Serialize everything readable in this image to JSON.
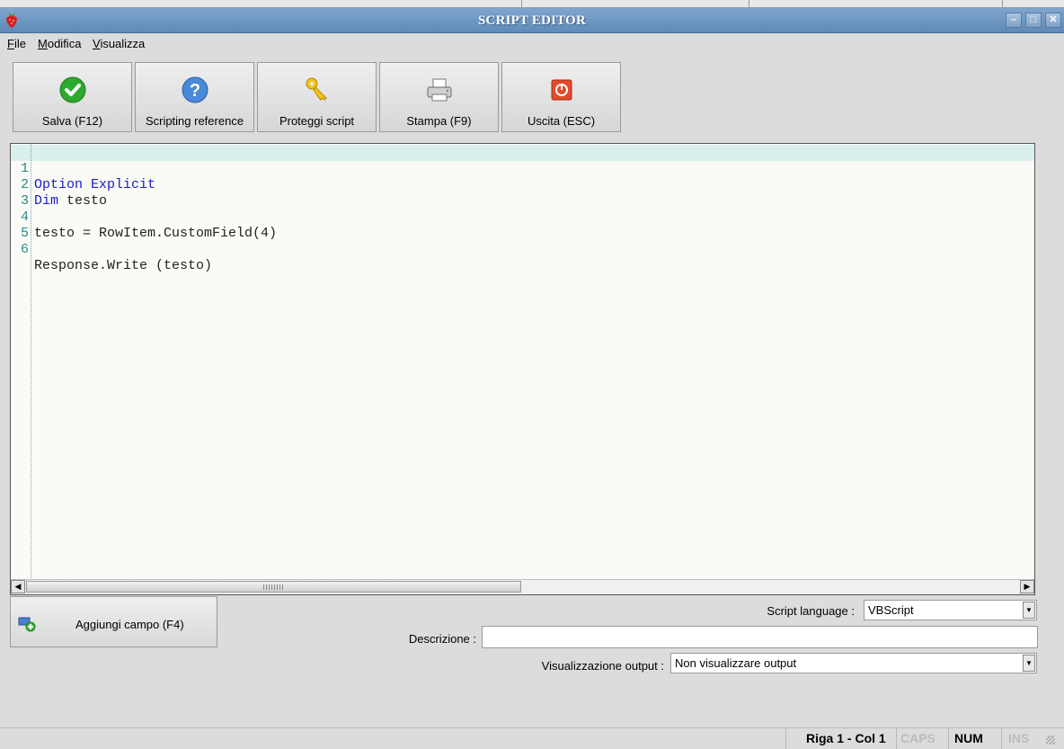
{
  "window": {
    "title": "SCRIPT EDITOR",
    "controls": {
      "minimize": "–",
      "maximize": "□",
      "close": "✕"
    }
  },
  "menu": [
    {
      "label": "File"
    },
    {
      "label": "Modifica"
    },
    {
      "label": "Visualizza"
    }
  ],
  "toolbar": [
    {
      "label": "Salva (F12)",
      "icon": "check-icon"
    },
    {
      "label": "Scripting reference",
      "icon": "help-icon"
    },
    {
      "label": "Proteggi script",
      "icon": "key-icon"
    },
    {
      "label": "Stampa (F9)",
      "icon": "printer-icon"
    },
    {
      "label": "Uscita (ESC)",
      "icon": "power-icon"
    }
  ],
  "editor": {
    "lines": [
      {
        "n": "1",
        "kw": "Option Explicit",
        "rest": ""
      },
      {
        "n": "2",
        "kw": "Dim",
        "rest": " testo"
      },
      {
        "n": "3",
        "kw": "",
        "rest": ""
      },
      {
        "n": "4",
        "kw": "",
        "rest": "testo = RowItem.CustomField(4)"
      },
      {
        "n": "5",
        "kw": "",
        "rest": ""
      },
      {
        "n": "6",
        "kw": "",
        "rest": "Response.Write (testo)"
      }
    ],
    "current_line": 1
  },
  "add_field": {
    "label": "Aggiungi campo (F4)",
    "icon": "add-field-icon"
  },
  "form": {
    "script_language_label": "Script language :",
    "script_language_value": "VBScript",
    "description_label": "Descrizione :",
    "description_value": "",
    "output_label": "Visualizzazione output :",
    "output_value": "Non visualizzare output"
  },
  "status": {
    "position": "Riga 1 - Col 1",
    "caps": "CAPS",
    "num": "NUM",
    "ins": "INS"
  },
  "colors": {
    "titlebar": "#6f97c3",
    "keyword": "#1c1cc8",
    "line_number": "#2a8a8a",
    "current_line_bg": "#daf0ec"
  }
}
